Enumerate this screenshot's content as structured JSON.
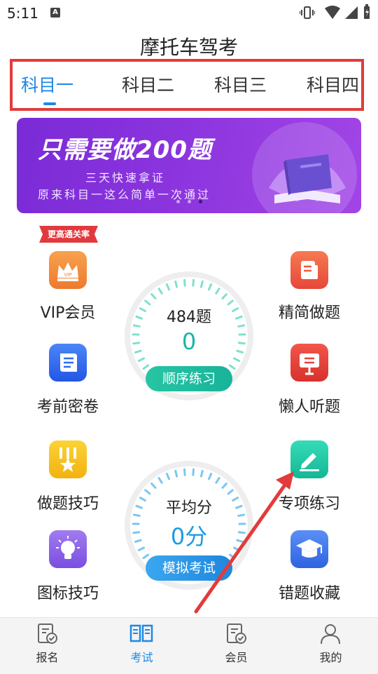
{
  "status_bar": {
    "time": "5:11",
    "notif_icon_letter": "A"
  },
  "app": {
    "title": "摩托车驾考"
  },
  "subject_tabs": [
    {
      "label": "科目一",
      "active": true
    },
    {
      "label": "科目二",
      "active": false
    },
    {
      "label": "科目三",
      "active": false
    },
    {
      "label": "科目四",
      "active": false
    }
  ],
  "banner": {
    "title": "只需要做200题",
    "line1": "三天快速拿证",
    "line2": "原来科目一这么简单一次通过"
  },
  "badge": "更高通关率",
  "left_features": [
    {
      "label": "VIP会员",
      "icon": "crown-icon",
      "color": "#f28b3c"
    },
    {
      "label": "考前密卷",
      "icon": "document-icon",
      "color": "#2f6bf2"
    },
    {
      "label": "做题技巧",
      "icon": "medal-icon",
      "color": "#f5c21a"
    },
    {
      "label": "图标技巧",
      "icon": "lightbulb-icon",
      "color": "#8a5ce6"
    }
  ],
  "right_features": [
    {
      "label": "精简做题",
      "icon": "notes-icon",
      "color": "#ef5a3c"
    },
    {
      "label": "懒人听题",
      "icon": "podcast-icon",
      "color": "#e5423c"
    },
    {
      "label": "专项练习",
      "icon": "pencil-icon",
      "color": "#1fc6a6"
    },
    {
      "label": "错题收藏",
      "icon": "graduation-cap-icon",
      "color": "#3d7cf0"
    }
  ],
  "practice_gauge": {
    "count": "484题",
    "done": "0",
    "button": "顺序练习"
  },
  "exam_gauge": {
    "caption": "平均分",
    "score": "0分",
    "button": "模拟考试"
  },
  "bottom_nav": [
    {
      "label": "报名",
      "icon": "register-icon",
      "active": false
    },
    {
      "label": "考试",
      "icon": "book-icon",
      "active": true
    },
    {
      "label": "会员",
      "icon": "member-icon",
      "active": false
    },
    {
      "label": "我的",
      "icon": "person-icon",
      "active": false
    }
  ],
  "colors": {
    "accent": "#1e88e5",
    "highlight": "#e23b3b",
    "teal": "#19b6a4"
  }
}
